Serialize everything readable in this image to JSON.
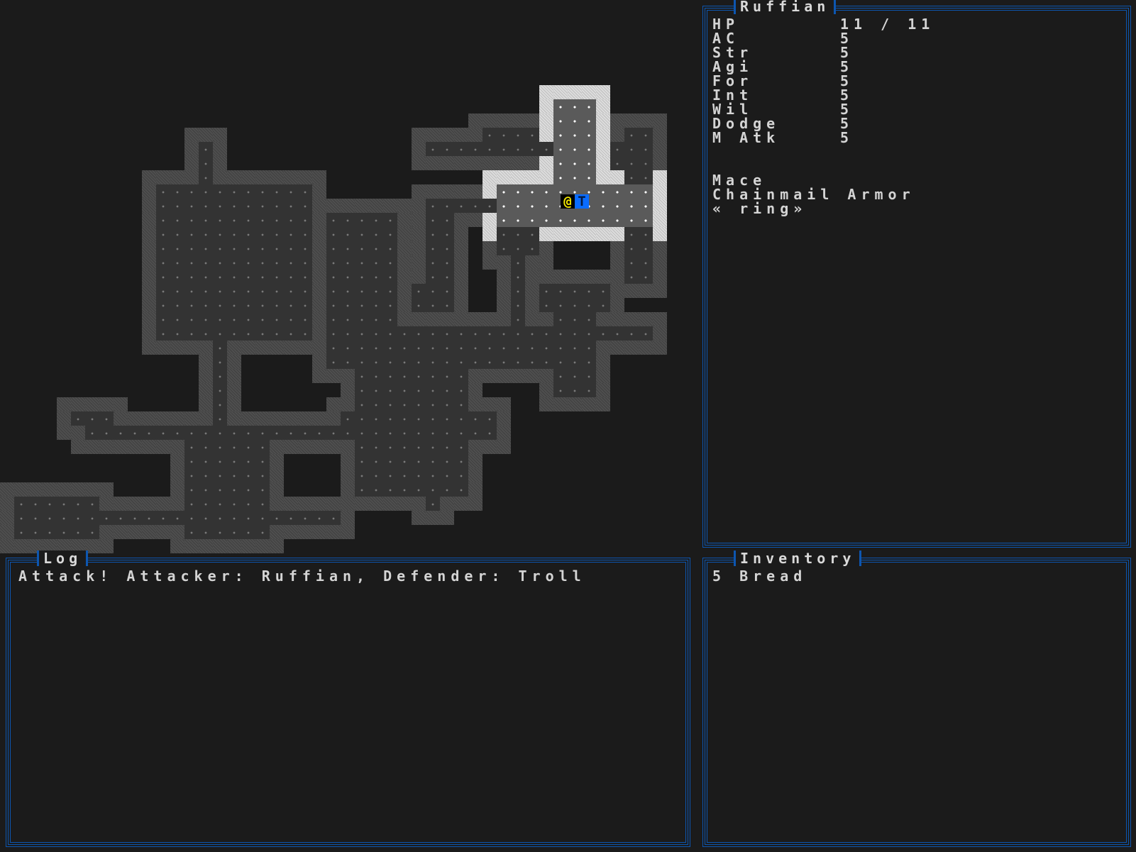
{
  "character": {
    "name": "Ruffian",
    "stats": [
      {
        "name": "HP",
        "value": "11 / 11"
      },
      {
        "name": "AC",
        "value": "5"
      },
      {
        "name": "Str",
        "value": "5"
      },
      {
        "name": "Agi",
        "value": "5"
      },
      {
        "name": "For",
        "value": "5"
      },
      {
        "name": "Int",
        "value": "5"
      },
      {
        "name": "Wil",
        "value": "5"
      },
      {
        "name": "Dodge",
        "value": "5"
      },
      {
        "name": "M Atk",
        "value": "5"
      }
    ],
    "equipment": [
      "Mace",
      "Chainmail Armor",
      "« ring»"
    ]
  },
  "log": {
    "title": "Log",
    "messages": [
      "Attack! Attacker: Ruffian, Defender: Troll"
    ]
  },
  "inventory": {
    "title": "Inventory",
    "items": [
      "5 Bread"
    ]
  },
  "map": {
    "player_glyph": "@",
    "troll_glyph": "T",
    "colors": {
      "background": "#1b1b1b",
      "panel_border": "#0d56b0",
      "player": "#f2e600",
      "troll": "#0a6cff",
      "text": "#d4d4d4"
    }
  }
}
